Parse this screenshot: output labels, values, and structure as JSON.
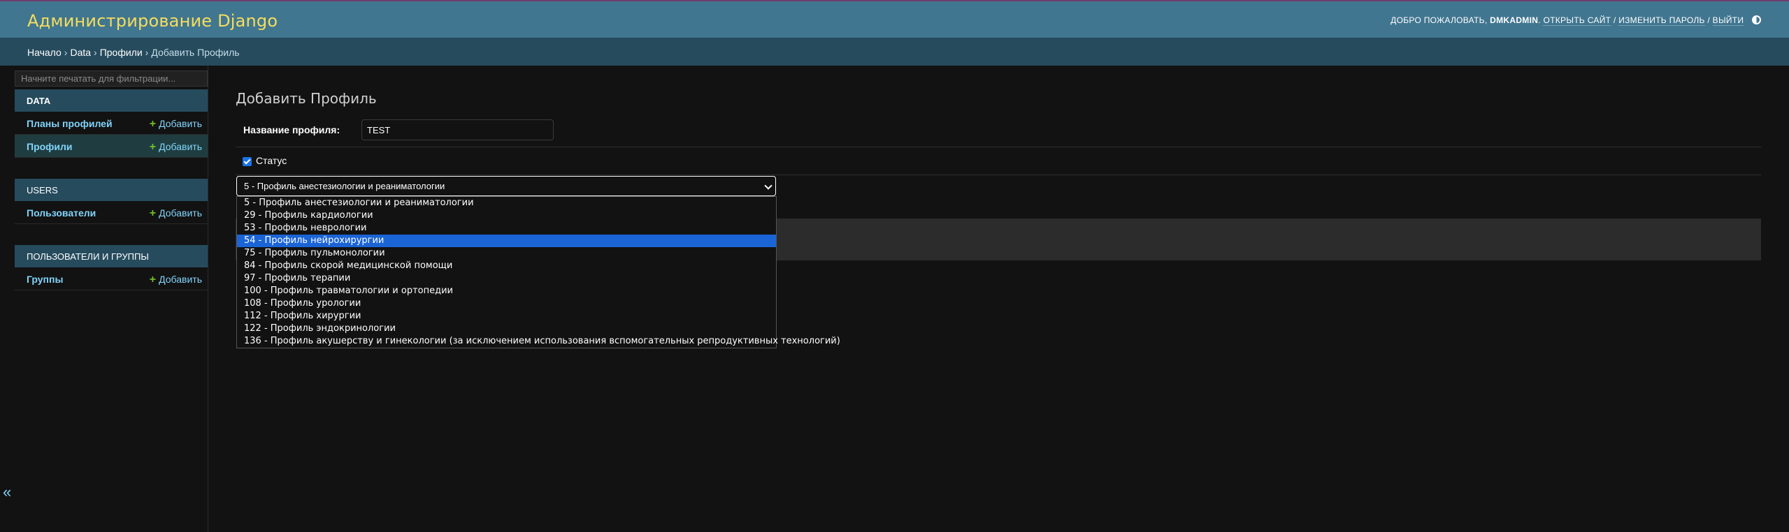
{
  "header": {
    "site_title": "Администрирование Django",
    "welcome": "ДОБРО ПОЖАЛОВАТЬ,",
    "username": "DMKADMIN",
    "view_site": "ОТКРЫТЬ САЙТ",
    "change_password": "ИЗМЕНИТЬ ПАРОЛЬ",
    "logout": "ВЫЙТИ",
    "separator": "/"
  },
  "breadcrumbs": {
    "home": "Начало",
    "app": "Data",
    "model": "Профили",
    "current": "Добавить Профиль",
    "sep": "›"
  },
  "sidebar": {
    "filter_placeholder": "Начните печатать для фильтрации...",
    "add_label": "Добавить",
    "modules": [
      {
        "caption": "DATA",
        "models": [
          {
            "name": "Планы профилей"
          },
          {
            "name": "Профили"
          }
        ]
      },
      {
        "caption": "USERS",
        "models": [
          {
            "name": "Пользователи"
          }
        ]
      },
      {
        "caption": "ПОЛЬЗОВАТЕЛИ И ГРУППЫ",
        "models": [
          {
            "name": "Группы"
          }
        ]
      }
    ],
    "collapse_glyph": "«"
  },
  "content": {
    "title": "Добавить Профиль",
    "name_label": "Название профиля:",
    "name_value": "TEST",
    "status_label": "Статус",
    "status_checked": true,
    "select_value": "5 - Профиль анестезиологии и реаниматологии",
    "options": [
      "5 - Профиль анестезиологии и реаниматологии",
      "29 - Профиль кардиологии",
      "53 - Профиль неврологии",
      "54 - Профиль нейрохирургии",
      "75 - Профиль пульмонологии",
      "84 - Профиль скорой медицинской помощи",
      "97 - Профиль терапии",
      "100 - Профиль травматологии и ортопедии",
      "108 - Профиль урологии",
      "112 - Профиль хирургии",
      "122 - Профиль эндокринологии",
      "136 - Профиль акушерству и гинекологии (за исключением использования вспомогательных репродуктивных технологий)"
    ],
    "highlighted_option": "54 - Профиль нейрохирургии"
  },
  "colors": {
    "header_bg": "#417690",
    "breadcrumbs_bg": "#264b5d",
    "brand": "#f5dd5d",
    "link": "#81d4fa",
    "add_plus": "#70bf2b",
    "highlight": "#1a64d6"
  }
}
